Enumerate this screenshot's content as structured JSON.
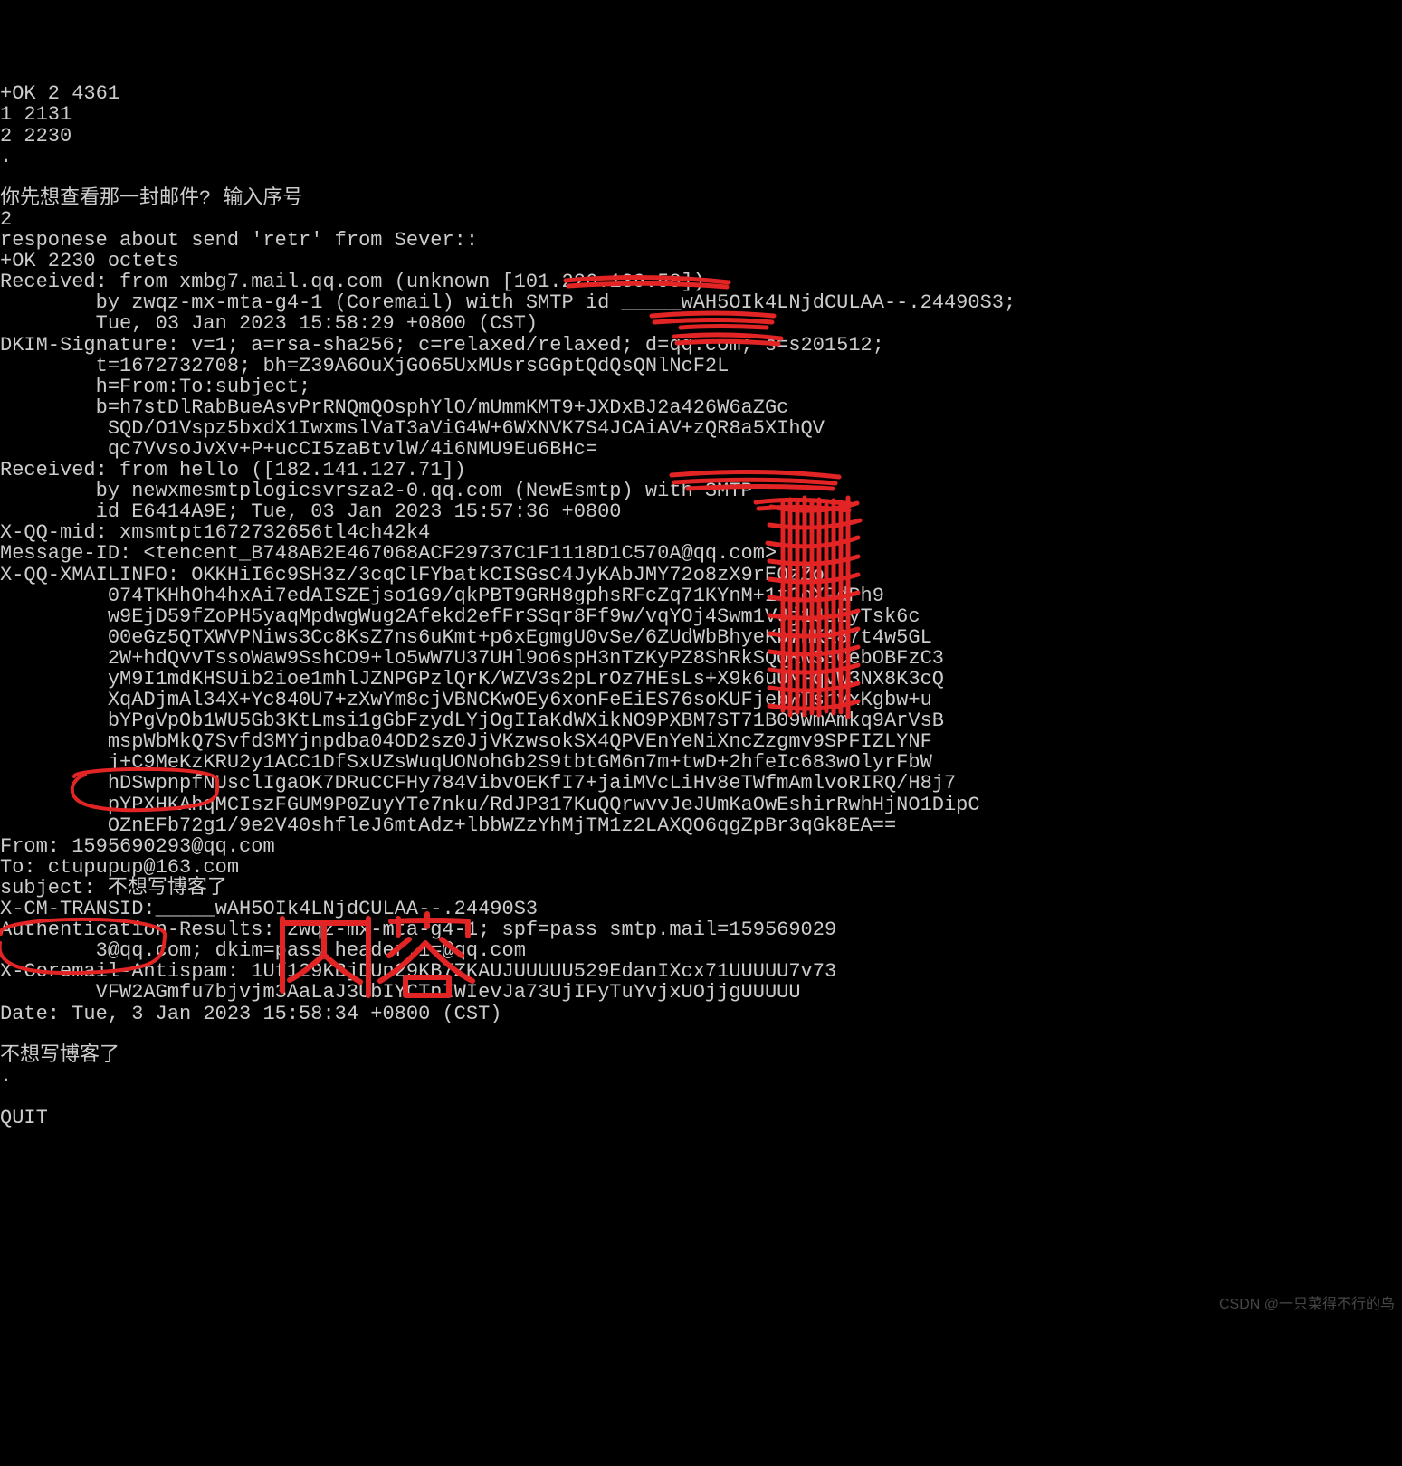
{
  "lines": [
    "+OK 2 4361",
    "1 2131",
    "2 2230",
    ".",
    "",
    "你先想查看那一封邮件? 输入序号",
    "2",
    "responese about send 'retr' from Sever::",
    "+OK 2230 octets",
    "Received: from xmbg7.mail.qq.com (unknown [101.226.139.58])",
    "        by zwqz-mx-mta-g4-1 (Coremail) with SMTP id _____wAH5OIk4LNjdCULAA--.24490S3;",
    "        Tue, 03 Jan 2023 15:58:29 +0800 (CST)",
    "DKIM-Signature: v=1; a=rsa-sha256; c=relaxed/relaxed; d=qq.com; s=s201512;",
    "        t=1672732708; bh=Z39A6OuXjGO65UxMUsrsGGptQdQsQNlNcF2L",
    "        h=From:To:subject;",
    "        b=h7stDlRabBueAsvPrRNQmQOsphYlO/mUmmKMT9+JXDxBJ2a426W6aZGc",
    "         SQD/O1Vspz5bxdX1IwxmslVaT3aViG4W+6WXNVK7S4JCAiAV+zQR8a5XIhQV",
    "         qc7VvsoJvXv+P+ucCI5zaBtvlW/4i6NMU9Eu6BHc=",
    "Received: from hello ([182.141.127.71])",
    "        by newxmesmtplogicsvrsza2-0.qq.com (NewEsmtp) with SMTP",
    "        id E6414A9E; Tue, 03 Jan 2023 15:57:36 +0800",
    "X-QQ-mid: xmsmtpt1672732656tl4ch42k4",
    "Message-ID: <tencent_B748AB2E467068ACF29737C1F1118D1C570A@qq.com>",
    "X-QQ-XMAILINFO: OKKHiI6c9SH3z/3cqClFYbatkCISGsC4JyKAbJMY72o8zX9rE0zZo",
    "         074TKHhOh4hxAi7edAISZEjso1G9/qkPBT9GRH8gphsRFcZq71KYnM+1tCoXPdPh9",
    "         w9EjD59fZoPH5yaqMpdwgWug2Afekd2efFrSSqr8Ff9w/vqYOj4Swm1VJj1JLEyTsk6c",
    "         00eGz5QTXWVPNiws3Cc8KsZ7ns6uKmt+p6xEgmgU0vSe/6ZUdWbBhyeKb7HKA87t4w5GL",
    "         2W+hdQvvTssoWaw9SshCO9+lo5wW7U37UHl9o6spH3nTzKyPZ8ShRkSQQKwS3CebOBFzC3",
    "         yM9I1mdKHSUib2ioe1mhlJZNPGPzlQrK/WZV3s2pLrOz7HEsLs+X9k6uUMFqvW3NX8K3cQ",
    "         XqADjmAl34X+Yc840U7+zXwYm8cjVBNCKwOEy6xonFeEiES76soKUFjebwTsnyxKgbw+u",
    "         bYPgVpOb1WU5Gb3KtLmsi1gGbFzydLYjOgIIaKdWXikNO9PXBM7ST71B09WmAmkq9ArVsB",
    "         mspWbMkQ7Svfd3MYjnpdba04OD2sz0JjVKzwsokSX4QPVEnYeNiXncZzgmv9SPFIZLYNF",
    "         j+C9MeKzKRU2y1ACC1DfSxUZsWuqUONohGb2S9tbtGM6n7m+twD+2hfeIc683wOlyrFbW",
    "         hDSwpnpfNUsclIgaOK7DRuCCFHy784VibvOEKfI7+jaiMVcLiHv8eTWfmAmlvoRIRQ/H8j7",
    "         pYPXHKAhqMCIszFGUM9P0ZuyYTe7nku/RdJP317KuQQrwvvJeJUmKaOwEshirRwhHjNO1DipC",
    "         OZnEFb72g1/9e2V40shfleJ6mtAdz+lbbWZzYhMjTM1z2LAXQO6qgZpBr3qGk8EA==",
    "From: 1595690293@qq.com",
    "To: ctupupup@163.com",
    "subject: 不想写博客了",
    "X-CM-TRANSID:_____wAH5OIk4LNjdCULAA--.24490S3",
    "Authentication-Results: zwqz-mx-mta-g4-1; spf=pass smtp.mail=159569029",
    "        3@qq.com; dkim=pass header.i=@qq.com",
    "X-Coremail-Antispam: 1Uf129KBjDUn29KB7ZKAUJUUUUU529EdanIXcx71UUUUU7v73",
    "        VFW2AGmfu7bjvjm3AaLaJ3UbIYCTnIWIevJa73UjIFyTuYvjxUOjjgUUUUU",
    "Date: Tue, 3 Jan 2023 15:58:34 +0800 (CST)",
    "",
    "不想写博客了",
    ".",
    "",
    "QUIT"
  ],
  "watermark": "CSDN @一只菜得不行的鸟",
  "annotations": {
    "ink": "内容"
  }
}
